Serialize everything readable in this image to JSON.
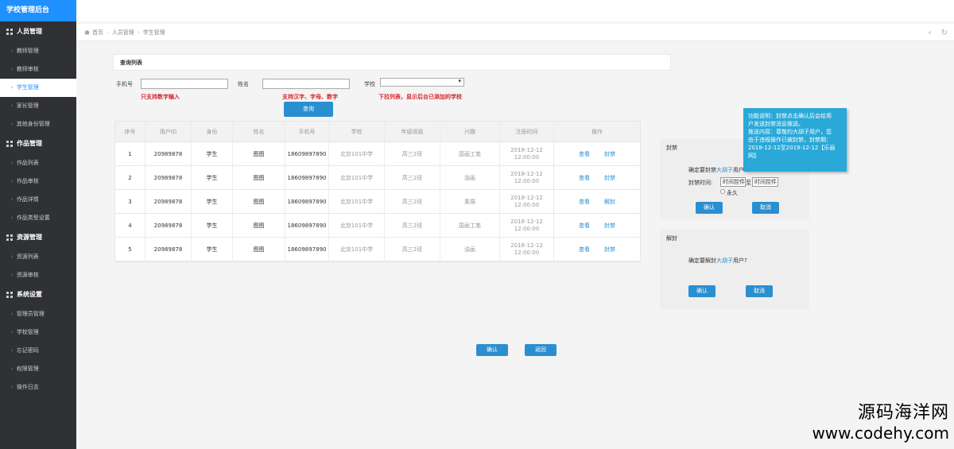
{
  "sidebar": {
    "brand": "学校管理后台",
    "groups": [
      {
        "label": "人员管理",
        "items": [
          "教师管理",
          "教师审核",
          "学生管理",
          "家长管理",
          "其他身份管理"
        ]
      },
      {
        "label": "作品管理",
        "items": [
          "作品列表",
          "作品审核",
          "作品详情",
          "作品类型设置"
        ]
      },
      {
        "label": "资源管理",
        "items": [
          "资源列表",
          "资源审核"
        ]
      },
      {
        "label": "系统设置",
        "items": [
          "管理员管理",
          "学校管理",
          "忘记密码",
          "权限管理",
          "操作日志"
        ]
      }
    ],
    "active_item": "学生管理"
  },
  "breadcrumb": [
    "首页",
    "人员管理",
    "学生管理"
  ],
  "query": {
    "panel_title": "查询列表",
    "phone_label": "手机号",
    "name_label": "姓名",
    "school_label": "学校",
    "phone_hint": "只支持数字输入",
    "name_hint": "支持汉字、字母、数字",
    "school_hint": "下拉列表，显示后台已添加的学校",
    "search_button": "查询"
  },
  "table": {
    "headers": [
      "序号",
      "用户ID",
      "身份",
      "姓名",
      "手机号",
      "学校",
      "年级班级",
      "兴趣",
      "注册时间",
      "操作"
    ],
    "rows": [
      {
        "no": "1",
        "uid": "20989878",
        "role": "学生",
        "name": "图图",
        "phone": "18609897890",
        "school": "北京101中学",
        "grade": "高三2班",
        "interest": "国画工笔",
        "time1": "2018-12-12",
        "time2": "12:00:00",
        "op1": "查看",
        "op2": "封禁"
      },
      {
        "no": "2",
        "uid": "20989878",
        "role": "学生",
        "name": "图图",
        "phone": "18609897890",
        "school": "北京101中学",
        "grade": "高三2班",
        "interest": "油画",
        "time1": "2018-12-12",
        "time2": "12:00:00",
        "op1": "查看",
        "op2": "封禁"
      },
      {
        "no": "3",
        "uid": "20989878",
        "role": "学生",
        "name": "图图",
        "phone": "18609897890",
        "school": "北京101中学",
        "grade": "高三2班",
        "interest": "素描",
        "time1": "2018-12-12",
        "time2": "12:00:00",
        "op1": "查看",
        "op2": "解封"
      },
      {
        "no": "4",
        "uid": "20989878",
        "role": "学生",
        "name": "图图",
        "phone": "18609897890",
        "school": "北京101中学",
        "grade": "高三2班",
        "interest": "国画工笔",
        "time1": "2018-12-12",
        "time2": "12:00:00",
        "op1": "查看",
        "op2": "封禁"
      },
      {
        "no": "5",
        "uid": "20989878",
        "role": "学生",
        "name": "图图",
        "phone": "18609897890",
        "school": "北京101中学",
        "grade": "高三2班",
        "interest": "油画",
        "time1": "2018-12-12",
        "time2": "12:00:00",
        "op1": "查看",
        "op2": "封禁"
      }
    ]
  },
  "ban_panel": {
    "title": "封禁",
    "question_pre": "确定要封禁",
    "question_user": "大胡子",
    "question_post": "用户?",
    "time_label": "封禁时间:",
    "time_from": "时间控件",
    "time_to_sep": "至",
    "time_to": "时间控件",
    "forever": "永久",
    "confirm": "确认",
    "cancel": "取消"
  },
  "unban_panel": {
    "title": "解封",
    "question_pre": "确定要解封",
    "question_user": "大胡子",
    "question_post": "用户?",
    "confirm": "确认",
    "cancel": "取消"
  },
  "info_box": {
    "line1": "功能说明：封禁点击确认后会给用",
    "line2": "户发送封禁消息推送。",
    "line3": "推送内容：尊敬的大胡子用户，您",
    "line4": "由于违规操作已被封禁，封禁期：",
    "line5": "2018-12-12至2019-12-12【乐画",
    "line6": "网】"
  },
  "footer_buttons": {
    "confirm": "确认",
    "back": "返回"
  },
  "watermark": {
    "line1": "源码海洋网",
    "line2": "www.codehy.com"
  }
}
